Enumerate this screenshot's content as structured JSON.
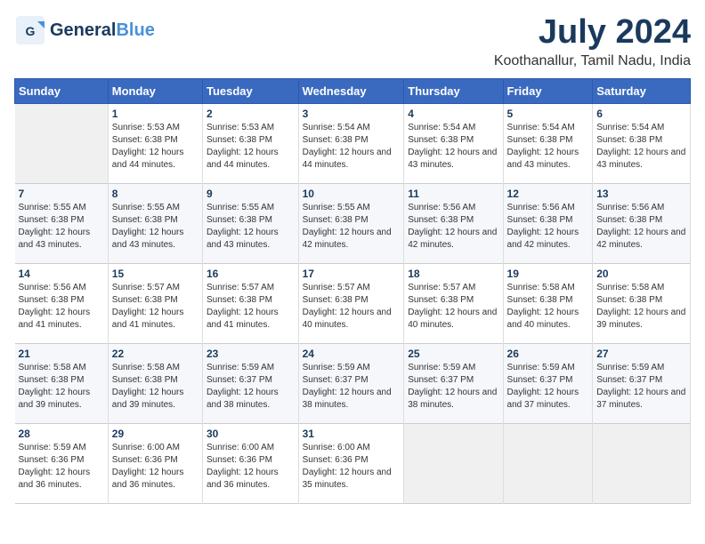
{
  "header": {
    "logo_general": "General",
    "logo_blue": "Blue",
    "month_title": "July 2024",
    "location": "Koothanallur, Tamil Nadu, India"
  },
  "days_of_week": [
    "Sunday",
    "Monday",
    "Tuesday",
    "Wednesday",
    "Thursday",
    "Friday",
    "Saturday"
  ],
  "weeks": [
    [
      {
        "day": "",
        "empty": true
      },
      {
        "day": "1",
        "sunrise": "Sunrise: 5:53 AM",
        "sunset": "Sunset: 6:38 PM",
        "daylight": "Daylight: 12 hours and 44 minutes."
      },
      {
        "day": "2",
        "sunrise": "Sunrise: 5:53 AM",
        "sunset": "Sunset: 6:38 PM",
        "daylight": "Daylight: 12 hours and 44 minutes."
      },
      {
        "day": "3",
        "sunrise": "Sunrise: 5:54 AM",
        "sunset": "Sunset: 6:38 PM",
        "daylight": "Daylight: 12 hours and 44 minutes."
      },
      {
        "day": "4",
        "sunrise": "Sunrise: 5:54 AM",
        "sunset": "Sunset: 6:38 PM",
        "daylight": "Daylight: 12 hours and 43 minutes."
      },
      {
        "day": "5",
        "sunrise": "Sunrise: 5:54 AM",
        "sunset": "Sunset: 6:38 PM",
        "daylight": "Daylight: 12 hours and 43 minutes."
      },
      {
        "day": "6",
        "sunrise": "Sunrise: 5:54 AM",
        "sunset": "Sunset: 6:38 PM",
        "daylight": "Daylight: 12 hours and 43 minutes."
      }
    ],
    [
      {
        "day": "7",
        "sunrise": "Sunrise: 5:55 AM",
        "sunset": "Sunset: 6:38 PM",
        "daylight": "Daylight: 12 hours and 43 minutes."
      },
      {
        "day": "8",
        "sunrise": "Sunrise: 5:55 AM",
        "sunset": "Sunset: 6:38 PM",
        "daylight": "Daylight: 12 hours and 43 minutes."
      },
      {
        "day": "9",
        "sunrise": "Sunrise: 5:55 AM",
        "sunset": "Sunset: 6:38 PM",
        "daylight": "Daylight: 12 hours and 43 minutes."
      },
      {
        "day": "10",
        "sunrise": "Sunrise: 5:55 AM",
        "sunset": "Sunset: 6:38 PM",
        "daylight": "Daylight: 12 hours and 42 minutes."
      },
      {
        "day": "11",
        "sunrise": "Sunrise: 5:56 AM",
        "sunset": "Sunset: 6:38 PM",
        "daylight": "Daylight: 12 hours and 42 minutes."
      },
      {
        "day": "12",
        "sunrise": "Sunrise: 5:56 AM",
        "sunset": "Sunset: 6:38 PM",
        "daylight": "Daylight: 12 hours and 42 minutes."
      },
      {
        "day": "13",
        "sunrise": "Sunrise: 5:56 AM",
        "sunset": "Sunset: 6:38 PM",
        "daylight": "Daylight: 12 hours and 42 minutes."
      }
    ],
    [
      {
        "day": "14",
        "sunrise": "Sunrise: 5:56 AM",
        "sunset": "Sunset: 6:38 PM",
        "daylight": "Daylight: 12 hours and 41 minutes."
      },
      {
        "day": "15",
        "sunrise": "Sunrise: 5:57 AM",
        "sunset": "Sunset: 6:38 PM",
        "daylight": "Daylight: 12 hours and 41 minutes."
      },
      {
        "day": "16",
        "sunrise": "Sunrise: 5:57 AM",
        "sunset": "Sunset: 6:38 PM",
        "daylight": "Daylight: 12 hours and 41 minutes."
      },
      {
        "day": "17",
        "sunrise": "Sunrise: 5:57 AM",
        "sunset": "Sunset: 6:38 PM",
        "daylight": "Daylight: 12 hours and 40 minutes."
      },
      {
        "day": "18",
        "sunrise": "Sunrise: 5:57 AM",
        "sunset": "Sunset: 6:38 PM",
        "daylight": "Daylight: 12 hours and 40 minutes."
      },
      {
        "day": "19",
        "sunrise": "Sunrise: 5:58 AM",
        "sunset": "Sunset: 6:38 PM",
        "daylight": "Daylight: 12 hours and 40 minutes."
      },
      {
        "day": "20",
        "sunrise": "Sunrise: 5:58 AM",
        "sunset": "Sunset: 6:38 PM",
        "daylight": "Daylight: 12 hours and 39 minutes."
      }
    ],
    [
      {
        "day": "21",
        "sunrise": "Sunrise: 5:58 AM",
        "sunset": "Sunset: 6:38 PM",
        "daylight": "Daylight: 12 hours and 39 minutes."
      },
      {
        "day": "22",
        "sunrise": "Sunrise: 5:58 AM",
        "sunset": "Sunset: 6:38 PM",
        "daylight": "Daylight: 12 hours and 39 minutes."
      },
      {
        "day": "23",
        "sunrise": "Sunrise: 5:59 AM",
        "sunset": "Sunset: 6:37 PM",
        "daylight": "Daylight: 12 hours and 38 minutes."
      },
      {
        "day": "24",
        "sunrise": "Sunrise: 5:59 AM",
        "sunset": "Sunset: 6:37 PM",
        "daylight": "Daylight: 12 hours and 38 minutes."
      },
      {
        "day": "25",
        "sunrise": "Sunrise: 5:59 AM",
        "sunset": "Sunset: 6:37 PM",
        "daylight": "Daylight: 12 hours and 38 minutes."
      },
      {
        "day": "26",
        "sunrise": "Sunrise: 5:59 AM",
        "sunset": "Sunset: 6:37 PM",
        "daylight": "Daylight: 12 hours and 37 minutes."
      },
      {
        "day": "27",
        "sunrise": "Sunrise: 5:59 AM",
        "sunset": "Sunset: 6:37 PM",
        "daylight": "Daylight: 12 hours and 37 minutes."
      }
    ],
    [
      {
        "day": "28",
        "sunrise": "Sunrise: 5:59 AM",
        "sunset": "Sunset: 6:36 PM",
        "daylight": "Daylight: 12 hours and 36 minutes."
      },
      {
        "day": "29",
        "sunrise": "Sunrise: 6:00 AM",
        "sunset": "Sunset: 6:36 PM",
        "daylight": "Daylight: 12 hours and 36 minutes."
      },
      {
        "day": "30",
        "sunrise": "Sunrise: 6:00 AM",
        "sunset": "Sunset: 6:36 PM",
        "daylight": "Daylight: 12 hours and 36 minutes."
      },
      {
        "day": "31",
        "sunrise": "Sunrise: 6:00 AM",
        "sunset": "Sunset: 6:36 PM",
        "daylight": "Daylight: 12 hours and 35 minutes."
      },
      {
        "day": "",
        "empty": true
      },
      {
        "day": "",
        "empty": true
      },
      {
        "day": "",
        "empty": true
      }
    ]
  ]
}
